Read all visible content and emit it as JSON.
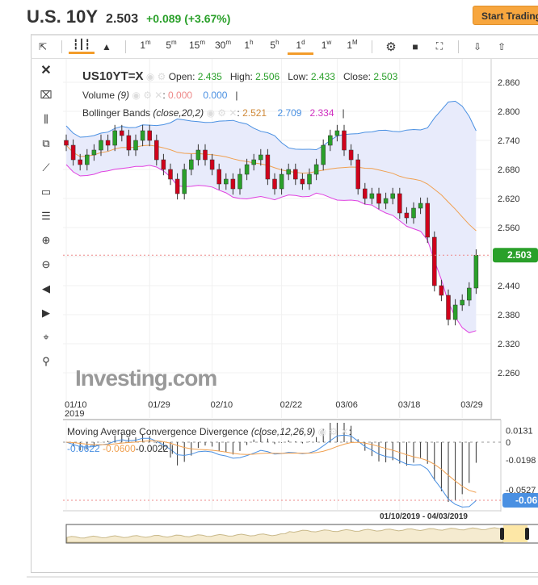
{
  "header": {
    "title": "U.S. 10Y",
    "price": "2.503",
    "change": "+0.089 (+3.67%)",
    "cta": "Start Trading"
  },
  "toolbar": {
    "timeframes": [
      {
        "b": "1",
        "s": "m"
      },
      {
        "b": "5",
        "s": "m"
      },
      {
        "b": "15",
        "s": "m"
      },
      {
        "b": "30",
        "s": "m"
      },
      {
        "b": "1",
        "s": "h"
      },
      {
        "b": "5",
        "s": "h"
      },
      {
        "b": "1",
        "s": "d"
      },
      {
        "b": "1",
        "s": "w"
      },
      {
        "b": "1",
        "s": "M"
      }
    ],
    "active": "1d"
  },
  "legend": {
    "symbol": "US10YT=X",
    "open_label": "Open:",
    "open": "2.435",
    "high_label": "High:",
    "high": "2.506",
    "low_label": "Low:",
    "low": "2.433",
    "close_label": "Close:",
    "close": "2.503",
    "volume": "Volume",
    "volume_params": "(9)",
    "vol_a": "0.000",
    "vol_b": "0.000",
    "bb": "Bollinger Bands",
    "bb_params": "(close,20,2)",
    "bb_mid": "2.521",
    "bb_up": "2.709",
    "bb_low": "2.334"
  },
  "macd_legend": {
    "name": "Moving Average Convergence Divergence",
    "params": "(close,12,26,9)",
    "macd": "-0.0622",
    "signal": "-0.0600",
    "hist": "-0.0022"
  },
  "watermark": "Investing.com",
  "range_label": "01/10/2019 - 04/03/2019",
  "last_price_tag": "2.503",
  "macd_tag": "-0.06",
  "colors": {
    "up": "#2aa02a",
    "down": "#d0021b",
    "bb_upper": "#4a90e2",
    "bb_mid": "#f0a050",
    "bb_lower": "#e040e0",
    "accent": "#f39c2a"
  },
  "chart_data": {
    "type": "candlestick",
    "price_axis": [
      "2.860",
      "2.800",
      "2.740",
      "2.680",
      "2.620",
      "2.560",
      "2.500",
      "2.440",
      "2.380",
      "2.320",
      "2.260"
    ],
    "ylim": [
      2.23,
      2.88
    ],
    "date_ticks": [
      {
        "label": "01/10",
        "i": 0
      },
      {
        "label": "01/29",
        "i": 12
      },
      {
        "label": "02/10",
        "i": 21
      },
      {
        "label": "02/22",
        "i": 31
      },
      {
        "label": "03/06",
        "i": 39
      },
      {
        "label": "03/18",
        "i": 48
      },
      {
        "label": "03/29",
        "i": 57
      }
    ],
    "year_label": "2019",
    "closes": [
      2.73,
      2.7,
      2.69,
      2.71,
      2.72,
      2.74,
      2.73,
      2.76,
      2.75,
      2.72,
      2.74,
      2.76,
      2.74,
      2.7,
      2.68,
      2.66,
      2.63,
      2.68,
      2.7,
      2.72,
      2.7,
      2.68,
      2.65,
      2.66,
      2.64,
      2.67,
      2.69,
      2.7,
      2.71,
      2.66,
      2.64,
      2.67,
      2.68,
      2.66,
      2.65,
      2.67,
      2.69,
      2.73,
      2.75,
      2.76,
      2.72,
      2.7,
      2.64,
      2.62,
      2.63,
      2.61,
      2.62,
      2.63,
      2.59,
      2.58,
      2.6,
      2.61,
      2.54,
      2.44,
      2.42,
      2.37,
      2.4,
      2.41,
      2.435,
      2.503
    ],
    "macd_axis": [
      "0.0131",
      "0",
      "-0.0198",
      "-0.0527"
    ]
  }
}
